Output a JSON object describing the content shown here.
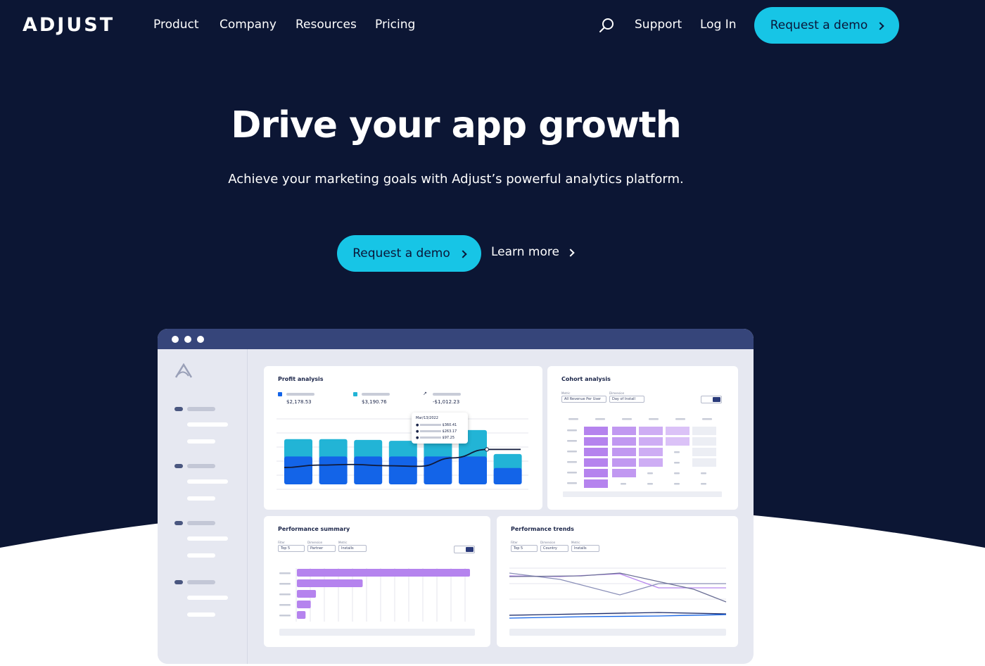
{
  "colors": {
    "navy_bg": "#0c1634",
    "cyan_accent": "#17c5e6",
    "bar_top": "#22b4d6",
    "bar_bottom": "#1364e8",
    "purple": "#b583ee",
    "window_chrome": "#36457a"
  },
  "nav": {
    "logo": "ADJUST",
    "links": [
      "Product",
      "Company",
      "Resources",
      "Pricing"
    ],
    "search_icon": "search-icon",
    "support": "Support",
    "login": "Log In",
    "cta": "Request a demo"
  },
  "hero": {
    "headline": "Drive your app growth",
    "subheadline": "Achieve your marketing goals with Adjust’s powerful analytics platform.",
    "cta_primary": "Request a demo",
    "cta_secondary": "Learn more"
  },
  "dashboard": {
    "profit": {
      "title": "Profit analysis",
      "stats": [
        "$2,178.53",
        "$3,190.76",
        "-$1,012.23"
      ],
      "tooltip": {
        "date": "Mar/13/2022",
        "values": [
          "$360.41",
          "$263.17",
          "$97.25"
        ]
      },
      "bars": [
        {
          "top": 0.42,
          "bottom": 0.58
        },
        {
          "top": 0.42,
          "bottom": 0.58
        },
        {
          "top": 0.4,
          "bottom": 0.58
        },
        {
          "top": 0.38,
          "bottom": 0.58
        },
        {
          "top": 0.5,
          "bottom": 0.58
        },
        {
          "top": 0.64,
          "bottom": 0.58
        },
        {
          "top": 0.34,
          "bottom": 0.34
        }
      ],
      "line": [
        0.28,
        0.32,
        0.33,
        0.31,
        0.3,
        0.44,
        0.58,
        0.58
      ]
    },
    "cohort": {
      "title": "Cohort analysis",
      "labels": [
        "Metric",
        "Dimension"
      ],
      "dropdowns": [
        "All Revenue Per User",
        "Day of Install"
      ]
    },
    "performance_summary": {
      "title": "Performance summary",
      "labels": [
        "Filter",
        "Dimension",
        "Metric"
      ],
      "dropdowns": [
        "Top 5",
        "Partner",
        "Installs"
      ],
      "bars": [
        1.0,
        0.38,
        0.11,
        0.08,
        0.05
      ]
    },
    "performance_trends": {
      "title": "Performance trends",
      "labels": [
        "Filter",
        "Dimension",
        "Metric"
      ],
      "dropdowns": [
        "Top 5",
        "Country",
        "Installs"
      ]
    }
  }
}
